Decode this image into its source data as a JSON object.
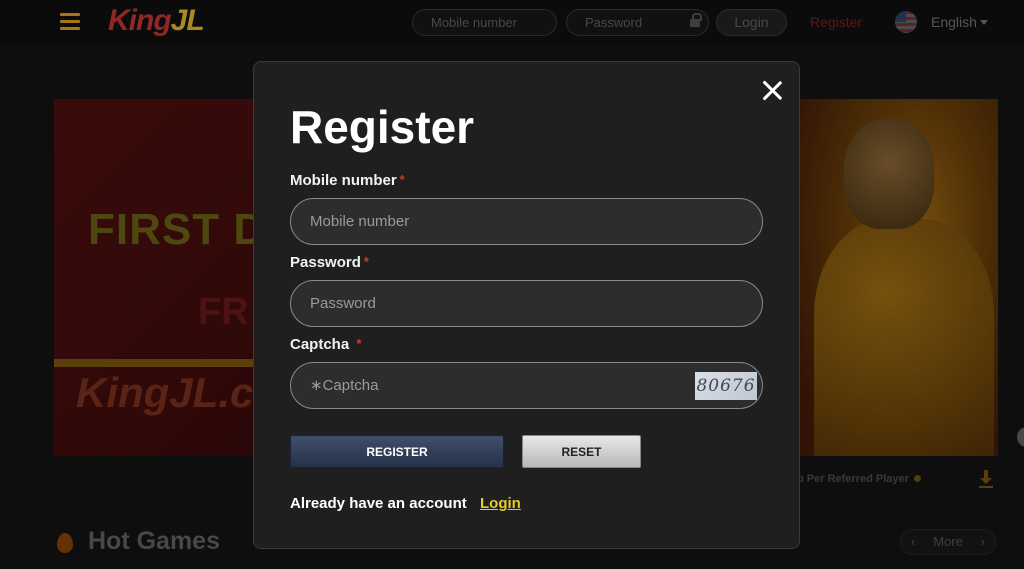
{
  "header": {
    "logo_text_a": "King",
    "logo_text_b": "JL",
    "mobile_placeholder": "Mobile number",
    "password_placeholder": "Password",
    "login_label": "Login",
    "register_label": "Register",
    "language": "English",
    "icons": [
      "menu-icon",
      "lock-icon",
      "flag-icon",
      "chevron-down-icon"
    ]
  },
  "banner": {
    "text1": "FIRST D",
    "text2": "FR",
    "logo": "KingJL.c",
    "caption": "p Per Referred Player"
  },
  "section": {
    "hot_games_title": "Hot Games",
    "more_label": "More"
  },
  "modal": {
    "title": "Register",
    "mobile_label": "Mobile number",
    "mobile_placeholder": "Mobile number",
    "password_label": "Password",
    "password_placeholder": "Password",
    "captcha_label": "Captcha",
    "captcha_placeholder": "∗Captcha",
    "captcha_code": "80676",
    "required_mark": "*",
    "register_button": "REGISTER",
    "reset_button": "RESET",
    "already_text": "Already have an account",
    "login_link": "Login"
  },
  "colors": {
    "modal_bg": "#1f1f1f",
    "accent_link": "#e5c82b",
    "required": "#d4362c",
    "register_btn": "#2f3c58"
  }
}
